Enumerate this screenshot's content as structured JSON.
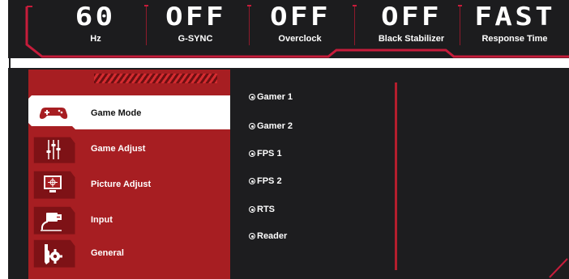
{
  "status": [
    {
      "value": "60",
      "label": "Hz"
    },
    {
      "value": "OFF",
      "label": "G-SYNC"
    },
    {
      "value": "OFF",
      "label": "Overclock"
    },
    {
      "value": "OFF",
      "label": "Black Stabilizer"
    },
    {
      "value": "FAST",
      "label": "Response Time"
    }
  ],
  "menu": {
    "items": [
      {
        "label": "Game Mode",
        "icon": "gamepad-icon",
        "active": true
      },
      {
        "label": "Game Adjust",
        "icon": "sliders-icon"
      },
      {
        "label": "Picture Adjust",
        "icon": "monitor-icon"
      },
      {
        "label": "Input",
        "icon": "input-icon"
      },
      {
        "label": "General",
        "icon": "wrench-gear-icon"
      }
    ]
  },
  "options": {
    "items": [
      "Gamer 1",
      "Gamer 2",
      "FPS 1",
      "FPS 2",
      "RTS",
      "Reader"
    ],
    "selected_index": 0
  },
  "colors": {
    "accent_red": "#c61c3b",
    "menu_red": "#a71e22",
    "panel_dark": "#1d1d1f"
  }
}
